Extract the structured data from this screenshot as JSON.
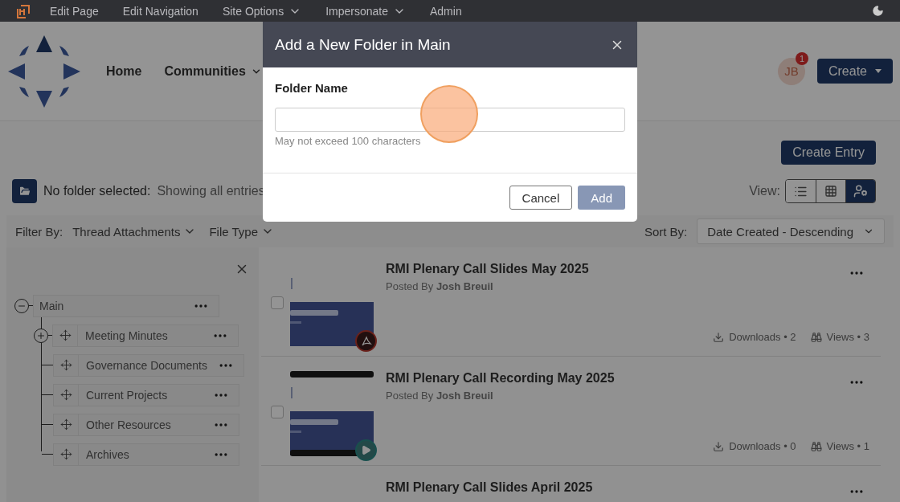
{
  "top_bar": {
    "items": [
      {
        "label": "Edit Page",
        "dropdown": false
      },
      {
        "label": "Edit Navigation",
        "dropdown": false
      },
      {
        "label": "Site Options",
        "dropdown": true
      },
      {
        "label": "Impersonate",
        "dropdown": true
      },
      {
        "label": "Admin",
        "dropdown": false
      }
    ]
  },
  "header": {
    "nav": [
      {
        "label": "Home",
        "dropdown": false
      },
      {
        "label": "Communities",
        "dropdown": true
      }
    ],
    "avatar": {
      "initials": "JB",
      "badge": "1"
    },
    "create_button": "Create"
  },
  "toolbar": {
    "create_entry": "Create Entry",
    "folder_status": {
      "label": "No folder selected:",
      "value": "Showing all entries"
    },
    "view": {
      "label": "View:",
      "options": [
        {
          "kind": "list",
          "selected": false
        },
        {
          "kind": "grid",
          "selected": false
        },
        {
          "kind": "people",
          "selected": true
        }
      ]
    }
  },
  "filter_bar": {
    "label": "Filter By:",
    "filters": [
      "Thread Attachments",
      "File Type"
    ],
    "sort_label": "Sort By:",
    "sort_value": "Date Created - Descending"
  },
  "tree": {
    "label": "Main",
    "expanded": true,
    "children": [
      {
        "label": "Meeting Minutes",
        "kind": "collapsed"
      },
      {
        "label": "Governance Documents",
        "kind": "leaf"
      },
      {
        "label": "Current Projects",
        "kind": "leaf"
      },
      {
        "label": "Other Resources",
        "kind": "leaf"
      },
      {
        "label": "Archives",
        "kind": "leaf"
      }
    ]
  },
  "entries": [
    {
      "title": "RMI Plenary Call Slides May 2025",
      "posted_by": "Posted By",
      "author": "Josh Breuil",
      "kind": "pdf",
      "checked": false,
      "downloads": "Downloads • 2",
      "views": "Views • 3"
    },
    {
      "title": "RMI Plenary Call Recording May 2025",
      "posted_by": "Posted By",
      "author": "Josh Breuil",
      "kind": "video",
      "checked": false,
      "downloads": "Downloads • 0",
      "views": "Views • 1"
    },
    {
      "title": "RMI Plenary Call Slides April 2025"
    }
  ],
  "modal": {
    "title": "Add a New Folder in Main",
    "field_label": "Folder Name",
    "hint": "May not exceed 100 characters",
    "cancel": "Cancel",
    "add": {
      "label": "Add",
      "disabled": true
    }
  }
}
